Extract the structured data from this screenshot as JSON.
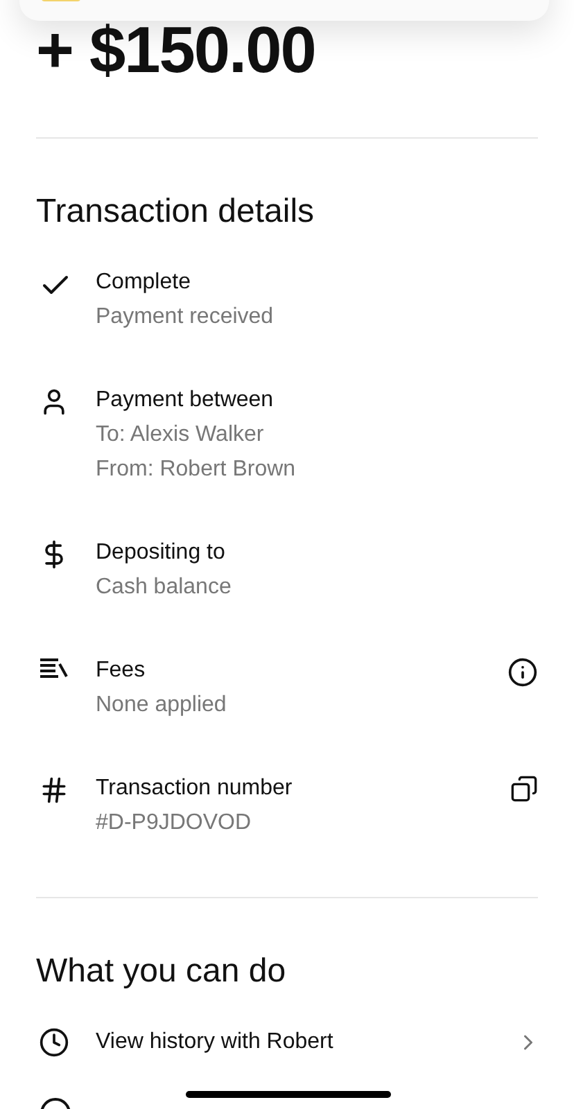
{
  "amount": "+ $150.00",
  "details": {
    "title": "Transaction details",
    "items": [
      {
        "title": "Complete",
        "lines": [
          "Payment received"
        ]
      },
      {
        "title": "Payment between",
        "lines": [
          "To: Alexis Walker",
          "From: Robert Brown"
        ]
      },
      {
        "title": "Depositing to",
        "lines": [
          "Cash balance"
        ]
      },
      {
        "title": "Fees",
        "lines": [
          "None applied"
        ]
      },
      {
        "title": "Transaction number",
        "lines": [
          "#D-P9JDOVOD"
        ]
      }
    ]
  },
  "actions": {
    "title": "What you can do",
    "items": [
      {
        "label": "View history with Robert"
      }
    ]
  }
}
